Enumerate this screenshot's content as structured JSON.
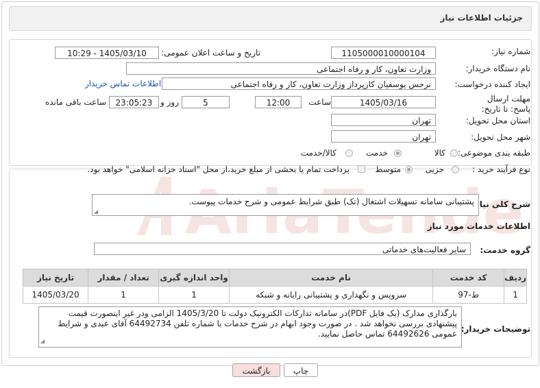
{
  "header": {
    "title": "جزئیات اطلاعات نیاز"
  },
  "form": {
    "need_number_label": "شماره نیاز:",
    "need_number": "1105000010000104",
    "announce_label": "تاریخ و ساعت اعلان عمومی:",
    "announce_value": "1405/03/10 - 10:29",
    "buyer_org_label": "نام دستگاه خریدار:",
    "buyer_org": "وزارت تعاون، کار و رفاه اجتماعی",
    "creator_label": "ایجاد کننده درخواست:",
    "creator": "نرجس یوسفیان کارپرداز وزارت تعاون، کار و رفاه اجتماعی",
    "contact_link": "اطلاعات تماس خریدار",
    "deadline_label": "مهلت ارسال پاسخ: تا تاریخ:",
    "deadline_date": "1405/03/16",
    "time_label": "ساعت",
    "deadline_time": "12:00",
    "days_value": "5",
    "days_label": "روز و",
    "remaining_time": "23:05:23",
    "remaining_label": "ساعت باقی مانده",
    "province_label": "استان محل تحویل:",
    "province": "تهران",
    "city_label": "شهر محل تحویل:",
    "city": "تهران",
    "category_label": "طبقه بندی موضوعی:",
    "category_options": [
      "کالا",
      "خدمت",
      "کالا/خدمت"
    ],
    "category_selected": "خدمت",
    "process_label": "نوع فرآیند خرید :",
    "process_options": [
      "جزیی",
      "متوسط"
    ],
    "process_selected": "متوسط",
    "payment_note": "پرداخت تمام یا بخشی از مبلغ خرید،از محل \"اسناد خزانه اسلامی\" خواهد بود."
  },
  "summary": {
    "label": "شرح کلی نیاز:",
    "text": "پشتیبانی سامانه تسهیلات اشتغال (تک) طبق شرایط عمومی و شرح خدمات پیوست."
  },
  "services": {
    "section_title": "اطلاعات خدمات مورد نیاز",
    "group_label": "گروه خدمت:",
    "group_value": "سایر فعالیت‌های خدماتی",
    "columns": [
      "ردیف",
      "کد خدمت",
      "نام خدمت",
      "واحد اندازه گیری",
      "تعداد / مقدار",
      "تاریخ نیاز"
    ],
    "rows": [
      [
        "1",
        "ط-97",
        "سرویس و نگهداری و پشتیبانی رایانه و شبکه",
        "1",
        "1",
        "1405/03/20"
      ]
    ]
  },
  "buyer_notes": {
    "label": "توضیحات خریدار:",
    "text": "بارگذاری مدارک (یک فایل PDF)در سامانه تدارکات الکترونیک دولت تا 1405/3/20 الزامی ودر غیر اینصورت قیمت پیشنهادی بررسی نخواهد شد . در صورت وجود ابهام در شرح خدمات با شماره تلفن 64492734 آقای عبدی و شرایط عمومی 64492626 تماس حاصل نمایید."
  },
  "buttons": {
    "print": "چاپ",
    "back": "بازگشت"
  },
  "watermark": {
    "text": "AriaTender.net"
  },
  "colors": {
    "link": "#1a56b4",
    "back_button": "#f9dede",
    "print_button": "#ffffff",
    "table_header": "#dcdcdc"
  }
}
